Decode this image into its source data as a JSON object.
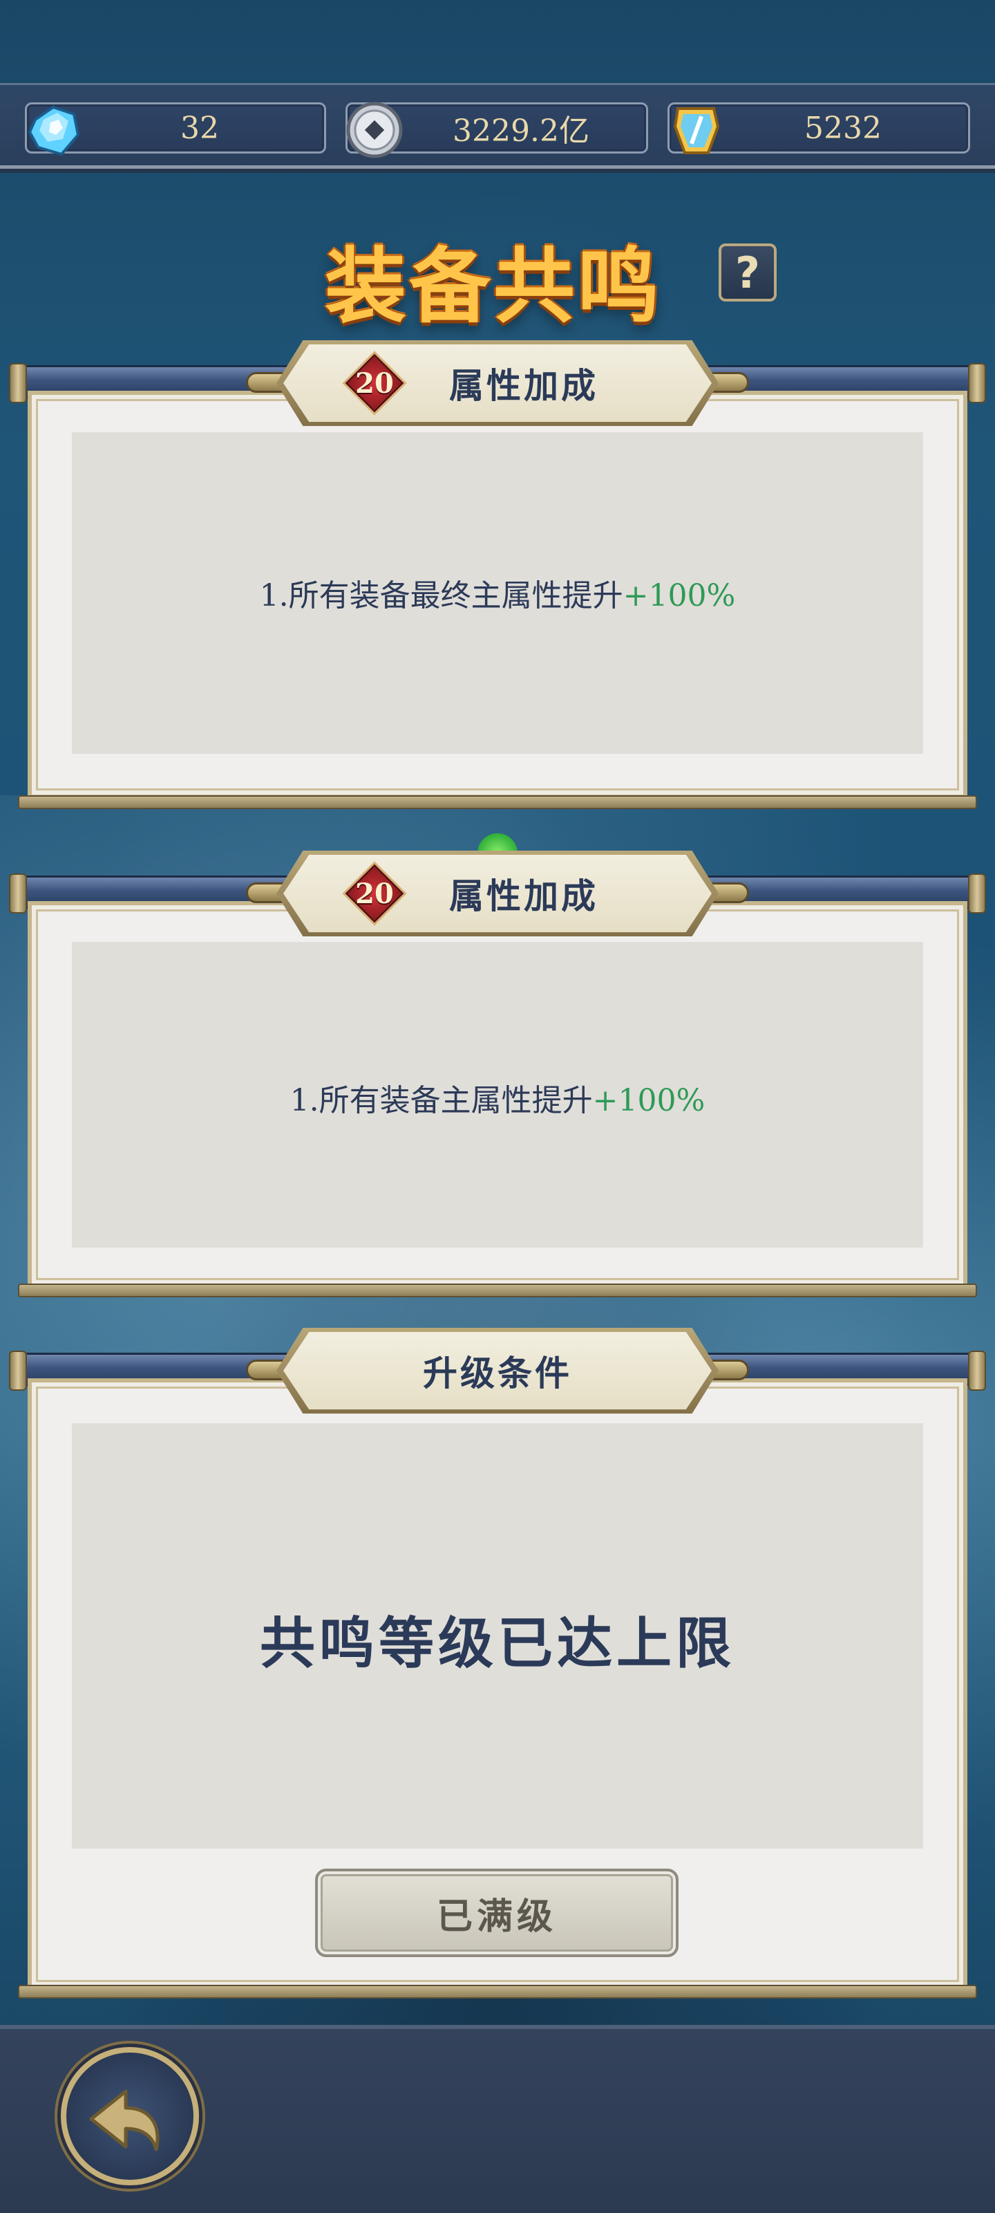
{
  "resources": {
    "gem": {
      "icon": "crystal-gem-icon",
      "value": "32"
    },
    "coin": {
      "icon": "silver-coin-icon",
      "value": "3229.2亿"
    },
    "token": {
      "icon": "sword-token-icon",
      "value": "5232"
    }
  },
  "title": "装备共鸣",
  "help_label": "?",
  "panels": [
    {
      "level": "20",
      "header": "属性加成",
      "line_prefix": "1.所有装备最终主属性提升",
      "line_value": "+100%"
    },
    {
      "level": "20",
      "header": "属性加成",
      "line_prefix": "1.所有装备主属性提升",
      "line_value": "+100%"
    }
  ],
  "upgrade": {
    "header": "升级条件",
    "status": "共鸣等级已达上限",
    "button_label": "已满级"
  },
  "colors": {
    "accent_green": "#2e9a56",
    "title_gold": "#ffc54a",
    "text_navy": "#2b3a58"
  }
}
